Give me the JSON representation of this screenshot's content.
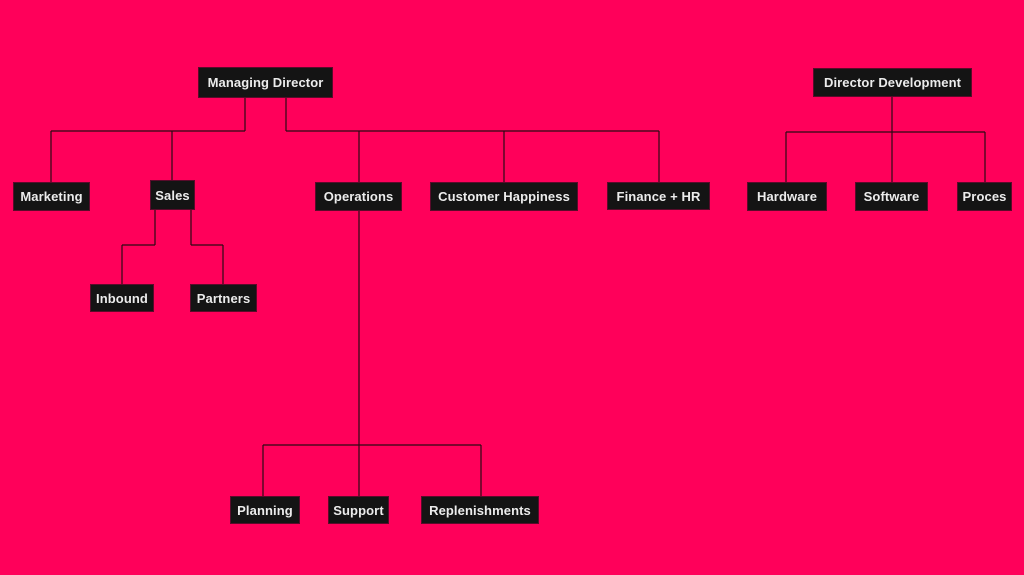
{
  "background_color": "#ff005a",
  "node_color": "#141414",
  "text_color": "#ececec",
  "nodes": {
    "managing_director": "Managing Director",
    "marketing": "Marketing",
    "sales": "Sales",
    "operations": "Operations",
    "customer_happiness": "Customer Happiness",
    "finance_hr": "Finance + HR",
    "inbound": "Inbound",
    "partners": "Partners",
    "planning": "Planning",
    "support": "Support",
    "replenishments": "Replenishments",
    "director_development": "Director Development",
    "hardware": "Hardware",
    "software": "Software",
    "proces": "Proces"
  },
  "edges": [
    [
      "managing_director",
      "marketing"
    ],
    [
      "managing_director",
      "sales"
    ],
    [
      "managing_director",
      "operations"
    ],
    [
      "managing_director",
      "customer_happiness"
    ],
    [
      "managing_director",
      "finance_hr"
    ],
    [
      "sales",
      "inbound"
    ],
    [
      "sales",
      "partners"
    ],
    [
      "operations",
      "planning"
    ],
    [
      "operations",
      "support"
    ],
    [
      "operations",
      "replenishments"
    ],
    [
      "director_development",
      "hardware"
    ],
    [
      "director_development",
      "software"
    ],
    [
      "director_development",
      "proces"
    ]
  ]
}
